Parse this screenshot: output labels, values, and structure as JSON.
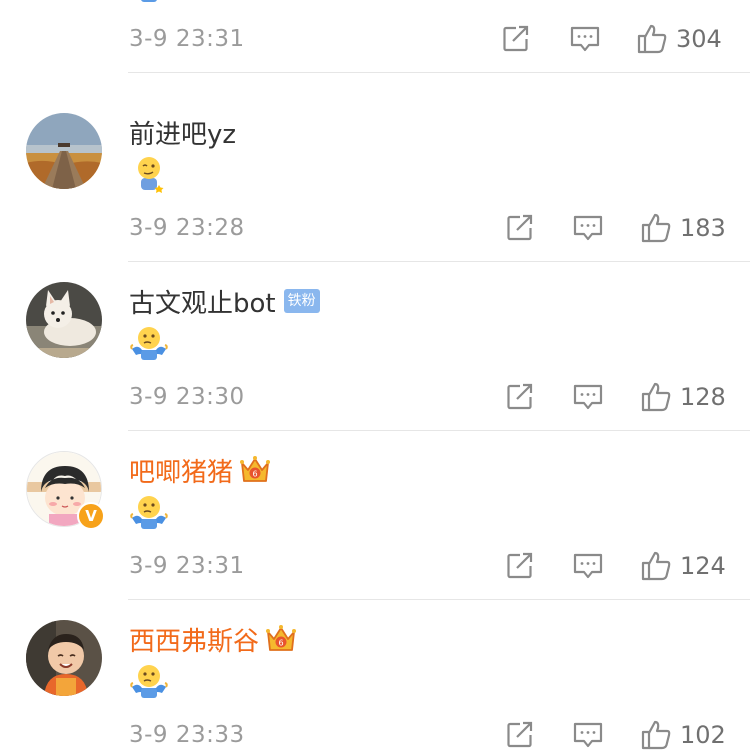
{
  "comments": [
    {
      "username": "",
      "emoji": "shrug-emoji",
      "timestamp": "3-9 23:31",
      "likes": "304"
    },
    {
      "username": "前进吧yz",
      "emoji": "smirk-emoji",
      "timestamp": "3-9 23:28",
      "likes": "183"
    },
    {
      "username": "古文观止bot",
      "fan_badge": "铁粉",
      "emoji": "shrug-emoji",
      "timestamp": "3-9 23:30",
      "likes": "128"
    },
    {
      "username": "吧唧猪猪",
      "verified_badge": "V",
      "emoji": "shrug-emoji",
      "timestamp": "3-9 23:31",
      "likes": "124"
    },
    {
      "username": "西西弗斯谷",
      "emoji": "shrug-emoji",
      "timestamp": "3-9 23:33",
      "likes": "102"
    }
  ],
  "icons": {
    "share": "share-icon",
    "reply": "comment-icon",
    "like": "thumbs-up-icon",
    "vip": "crown-icon"
  },
  "colors": {
    "vip_name": "#f26a1a",
    "normal_name": "#333333",
    "meta_gray": "#9b9b9b",
    "fan_badge": "#8ab7ee",
    "verified_badge": "#f7a21a"
  }
}
